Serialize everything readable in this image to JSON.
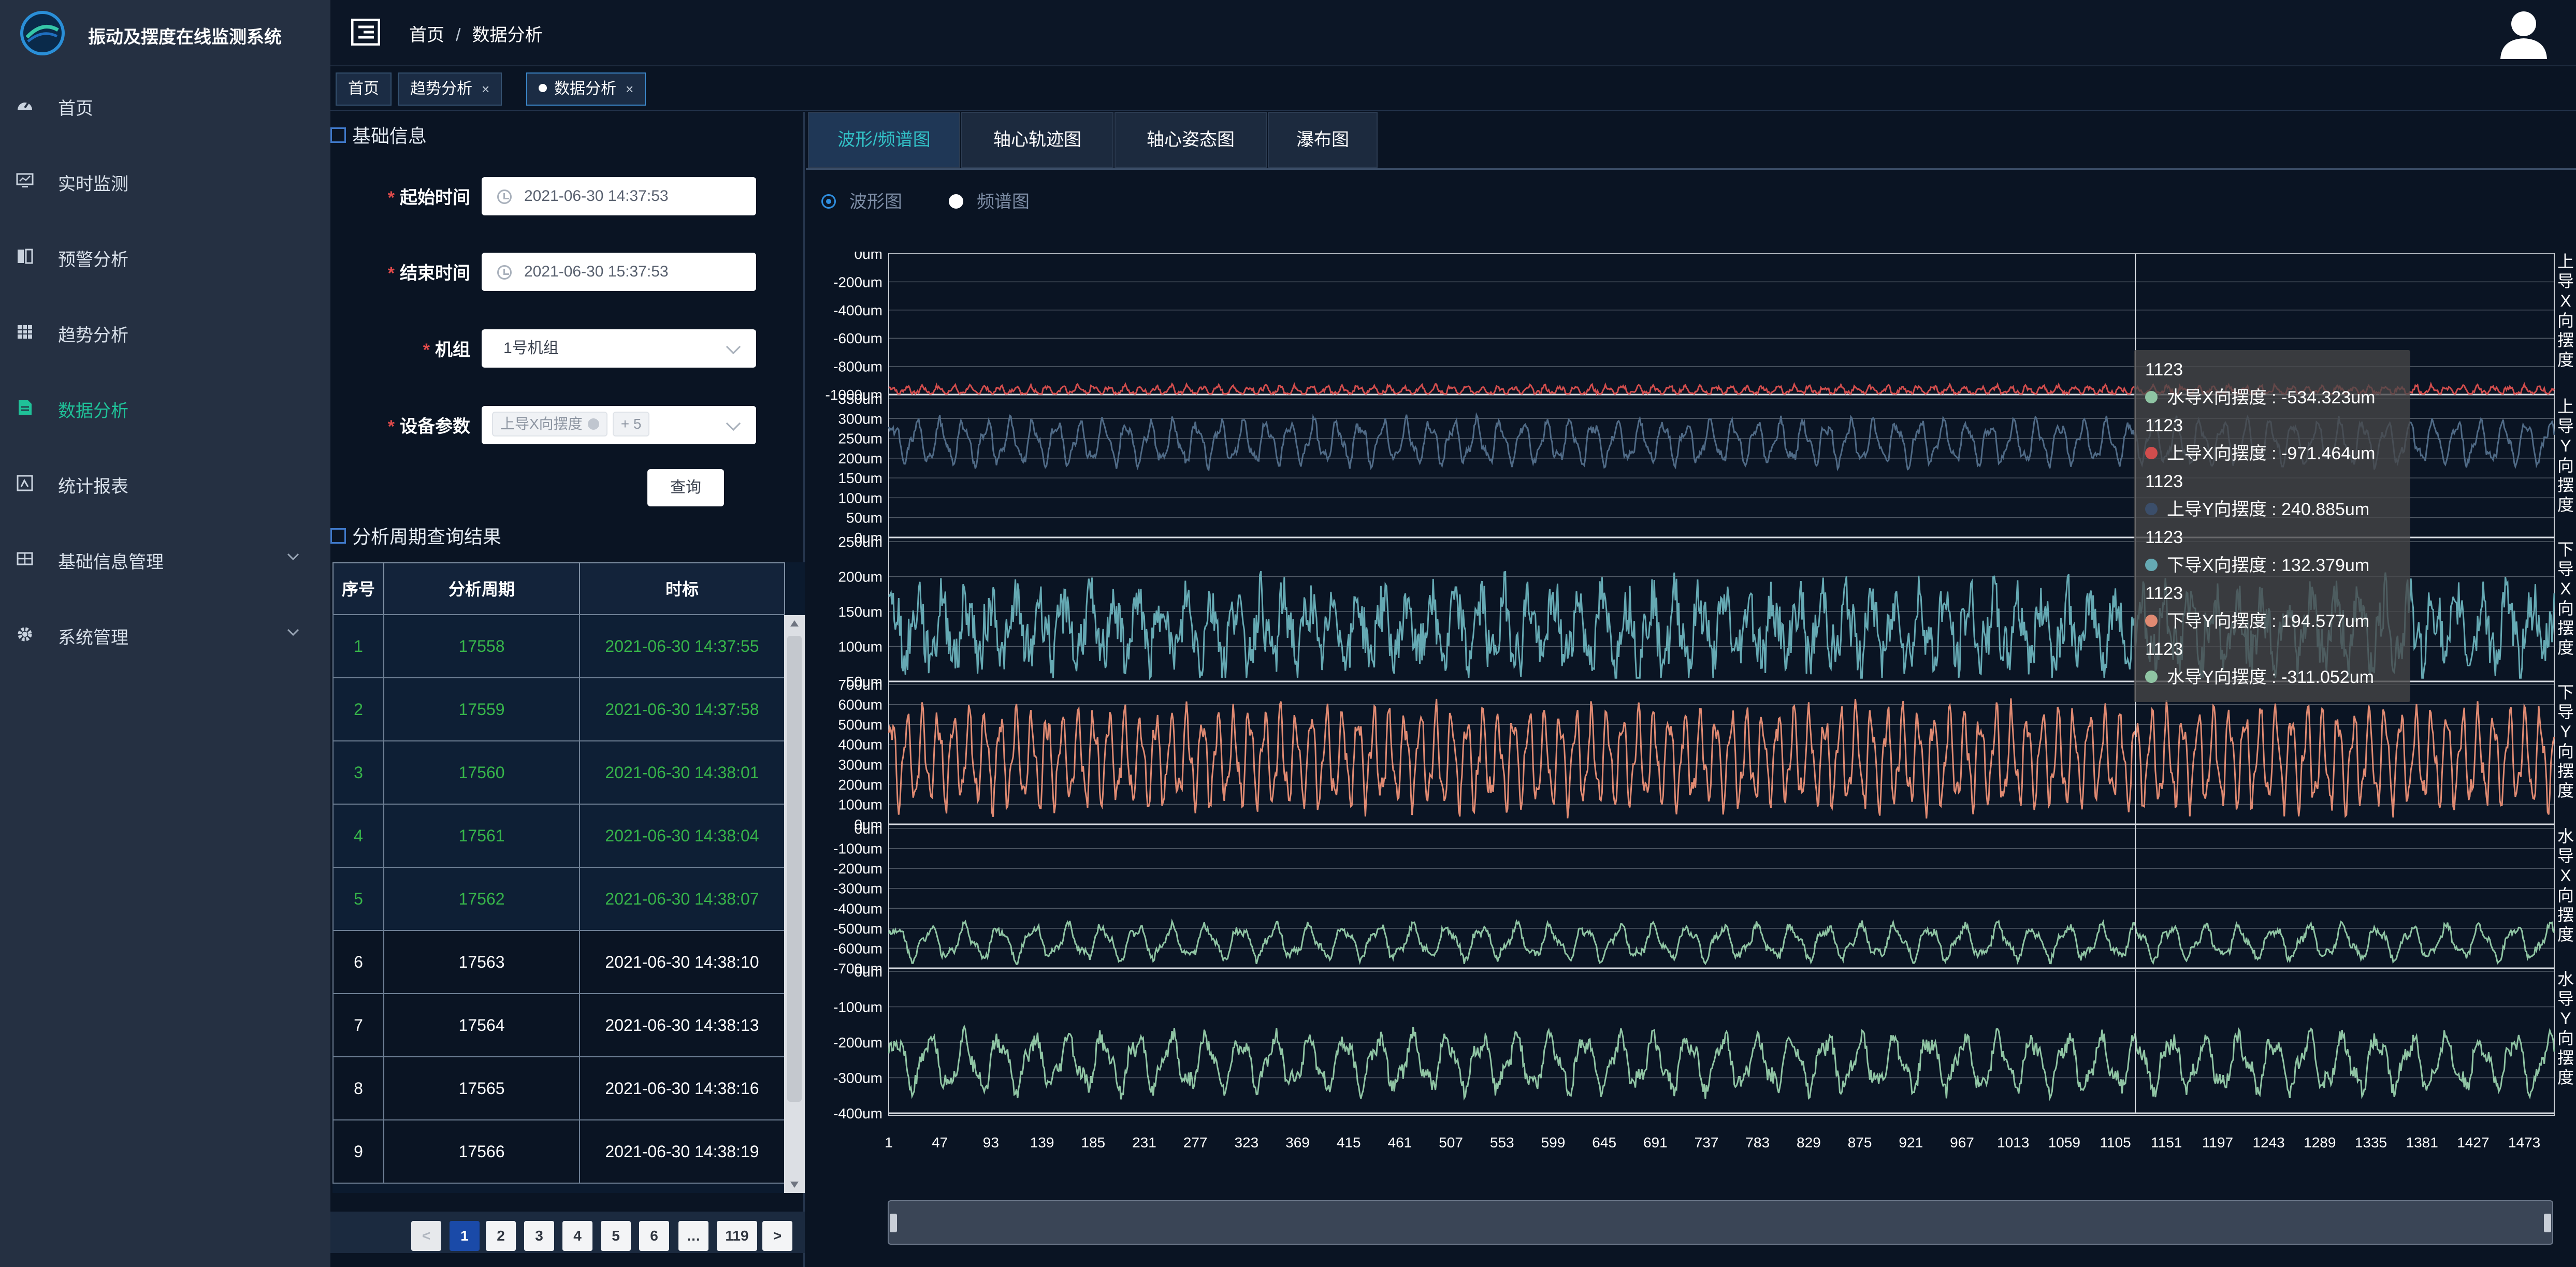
{
  "app": {
    "title": "振动及摆度在线监测系统"
  },
  "nav": {
    "items": [
      {
        "label": "首页",
        "icon": "dashboard-icon"
      },
      {
        "label": "实时监测",
        "icon": "monitor-icon"
      },
      {
        "label": "预警分析",
        "icon": "book-icon"
      },
      {
        "label": "趋势分析",
        "icon": "grid-icon"
      },
      {
        "label": "数据分析",
        "icon": "document-icon"
      },
      {
        "label": "统计报表",
        "icon": "report-icon"
      },
      {
        "label": "基础信息管理",
        "icon": "table-icon"
      },
      {
        "label": "系统管理",
        "icon": "gear-icon"
      }
    ]
  },
  "header": {
    "breadcrumb": [
      "首页",
      "数据分析"
    ]
  },
  "tags": [
    {
      "label": "首页"
    },
    {
      "label": "趋势分析"
    },
    {
      "label": "数据分析"
    }
  ],
  "basic_info": {
    "title": "基础信息",
    "start_label": "起始时间",
    "start_value": "2021-06-30 14:37:53",
    "end_label": "结束时间",
    "end_value": "2021-06-30 15:37:53",
    "unit_label": "机组",
    "unit_value": "1号机组",
    "param_label": "设备参数",
    "param_chip": "上导X向摆度",
    "param_more": "+ 5",
    "query_label": "查询"
  },
  "results": {
    "title": "分析周期查询结果",
    "columns": [
      "序号",
      "分析周期",
      "时标"
    ],
    "rows": [
      {
        "no": "1",
        "period": "17558",
        "time": "2021-06-30 14:37:55"
      },
      {
        "no": "2",
        "period": "17559",
        "time": "2021-06-30 14:37:58"
      },
      {
        "no": "3",
        "period": "17560",
        "time": "2021-06-30 14:38:01"
      },
      {
        "no": "4",
        "period": "17561",
        "time": "2021-06-30 14:38:04"
      },
      {
        "no": "5",
        "period": "17562",
        "time": "2021-06-30 14:38:07"
      },
      {
        "no": "6",
        "period": "17563",
        "time": "2021-06-30 14:38:10"
      },
      {
        "no": "7",
        "period": "17564",
        "time": "2021-06-30 14:38:13"
      },
      {
        "no": "8",
        "period": "17565",
        "time": "2021-06-30 14:38:16"
      },
      {
        "no": "9",
        "period": "17566",
        "time": "2021-06-30 14:38:19"
      }
    ],
    "pages": [
      "<",
      "1",
      "2",
      "3",
      "4",
      "5",
      "6",
      "…",
      "119",
      ">"
    ]
  },
  "chart_tabs": [
    "波形/频谱图",
    "轴心轨迹图",
    "轴心姿态图",
    "瀑布图"
  ],
  "view_mode": {
    "options": [
      "波形图",
      "频谱图"
    ],
    "selected": "波形图"
  },
  "tooltip": {
    "index": "1123",
    "rows": [
      {
        "label": "水导X向摆度 : -534.323um",
        "color": "#8fc4a3"
      },
      {
        "label": "上导X向摆度 : -971.464um",
        "color": "#d14d4d"
      },
      {
        "label": "上导Y向摆度 : 240.885um",
        "color": "#3b4e6a"
      },
      {
        "label": "下导X向摆度 : 132.379um",
        "color": "#65a9b3"
      },
      {
        "label": "下导Y向摆度 : 194.577um",
        "color": "#e08a72"
      },
      {
        "label": "水导Y向摆度 : -311.052um",
        "color": "#8fc4a3"
      }
    ]
  },
  "chart_data": {
    "type": "line",
    "x_ticks": [
      "1",
      "47",
      "93",
      "139",
      "185",
      "231",
      "277",
      "323",
      "369",
      "415",
      "461",
      "507",
      "553",
      "599",
      "645",
      "691",
      "737",
      "783",
      "829",
      "875",
      "921",
      "967",
      "1013",
      "1059",
      "1105",
      "1151",
      "1197",
      "1243",
      "1289",
      "1335",
      "1381",
      "1427",
      "1473"
    ],
    "x_range": [
      1,
      1500
    ],
    "cursor_x": 1123,
    "panels": [
      {
        "name": "上导X向摆度",
        "color": "#d14d4d",
        "y_ticks": [
          "0um",
          "-200um",
          "-400um",
          "-600um",
          "-800um",
          "-1000um"
        ],
        "ylim": [
          -1000,
          0
        ],
        "mean": -970,
        "amp": 25,
        "period": 14,
        "noise": 14
      },
      {
        "name": "上导Y向摆度",
        "color": "#4f6a86",
        "y_ticks": [
          "350um",
          "300um",
          "250um",
          "200um",
          "150um",
          "100um",
          "50um",
          "0um"
        ],
        "ylim": [
          0,
          350
        ],
        "mean": 240,
        "amp": 45,
        "period": 21,
        "noise": 10
      },
      {
        "name": "下导X向摆度",
        "color": "#65a9b3",
        "y_ticks": [
          "250um",
          "200um",
          "150um",
          "100um",
          "50um"
        ],
        "ylim": [
          50,
          250
        ],
        "mean": 125,
        "amp": 40,
        "period": 22,
        "noise": 35
      },
      {
        "name": "下导Y向摆度",
        "color": "#e08a72",
        "y_ticks": [
          "700um",
          "600um",
          "500um",
          "400um",
          "300um",
          "200um",
          "100um",
          "0um"
        ],
        "ylim": [
          0,
          700
        ],
        "mean": 330,
        "amp": 200,
        "period": 14,
        "noise": 40
      },
      {
        "name": "水导X向摆度",
        "color": "#8fc4a3",
        "y_ticks": [
          "0um",
          "-100um",
          "-200um",
          "-300um",
          "-400um",
          "-500um",
          "-600um",
          "-700um"
        ],
        "ylim": [
          -700,
          0
        ],
        "mean": -570,
        "amp": 70,
        "period": 31,
        "noise": 18
      },
      {
        "name": "水导Y向摆度",
        "color": "#8fc4a3",
        "y_ticks": [
          "0um",
          "-100um",
          "-200um",
          "-300um",
          "-400um"
        ],
        "ylim": [
          -450,
          0
        ],
        "mean": -290,
        "amp": 70,
        "period": 31,
        "noise": 25
      }
    ],
    "grid": true
  }
}
